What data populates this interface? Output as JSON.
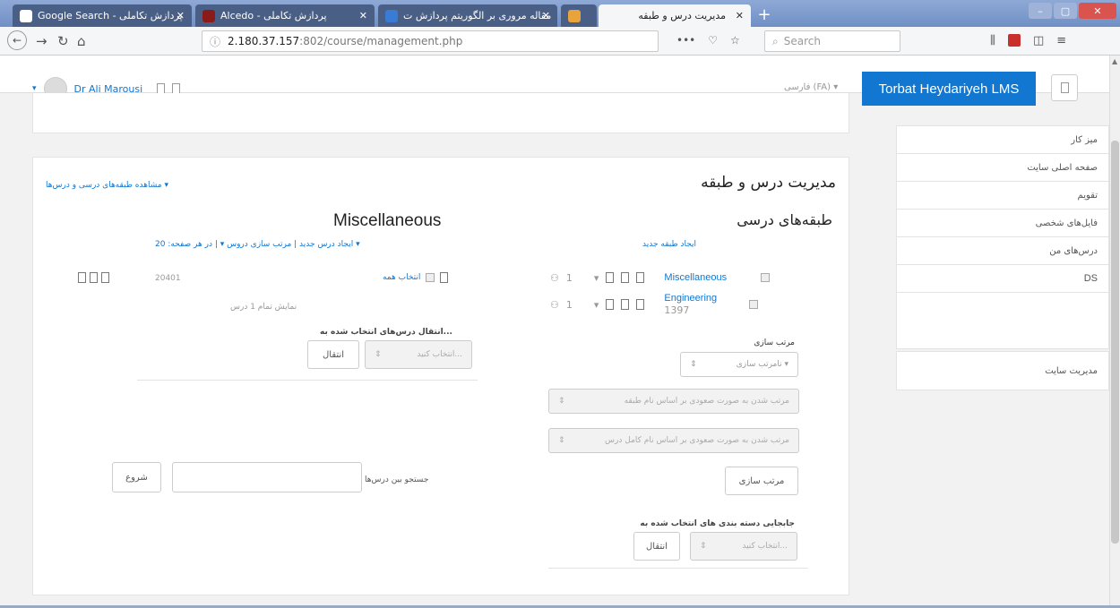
{
  "browser": {
    "tabs": [
      {
        "label": "Google Search - پردازش تکاملی"
      },
      {
        "label": "Alcedo - پردازش تکاملی"
      },
      {
        "label": "مقاله مروری بر الگوریتم پردازش ت"
      },
      {
        "label": ""
      },
      {
        "label": "مدیریت درس و طبقه"
      }
    ],
    "url_host": "2.180.37.157",
    "url_path": ":802/course/management.php",
    "search_placeholder": "Search"
  },
  "header": {
    "site_name": "Torbat Heydariyeh LMS",
    "user_name": "Dr Ali Marousi",
    "language": "فارسی (FA) ▾"
  },
  "sidebar": {
    "nav_items": [
      "میز کار",
      "صفحه اصلی سایت",
      "تقویم",
      "فایل‌های شخصی",
      "درس‌های من",
      "DS"
    ],
    "admin_item": "مدیریت سایت"
  },
  "main": {
    "page_title": "مدیریت درس و طبقه",
    "view_link": "مشاهده طبقه‌های درسی و درس‌ها ▾",
    "categories": {
      "heading": "طبقه‌های درسی",
      "create_link": "ایجاد طبقه جدید",
      "items": [
        {
          "name": "Miscellaneous",
          "count": "1"
        },
        {
          "name": "Engineering",
          "id": "1397",
          "count": "1"
        }
      ],
      "sort_label": "مرتب سازی",
      "sort_select": "نامرتب سازی ▾",
      "sort_option_a": "مرتب شدن به صورت صعودی بر اساس نام طبقه",
      "sort_option_b": "مرتب شدن به صورت صعودی بر اساس نام کامل درس",
      "sort_button": "مرتب سازی",
      "move_label": "جابجایی دسته بندی های انتخاب شده به",
      "move_select": "انتخاب کنید...",
      "move_button": "انتقال"
    },
    "courses": {
      "heading": "Miscellaneous",
      "links": "ایجاد درس جدید | مرتب سازی دروس ▾ | در هر صفحه: 20 ▾",
      "select_all": "انتخاب همه",
      "course_id": "20401",
      "showing": "نمایش تمام 1 درس",
      "move_label": "انتقال درس‌های انتخاب شده به...",
      "move_select": "انتخاب کنید...",
      "move_button": "انتقال",
      "search_label": "جستجو بین درس‌ها",
      "search_button": "شروع"
    }
  }
}
